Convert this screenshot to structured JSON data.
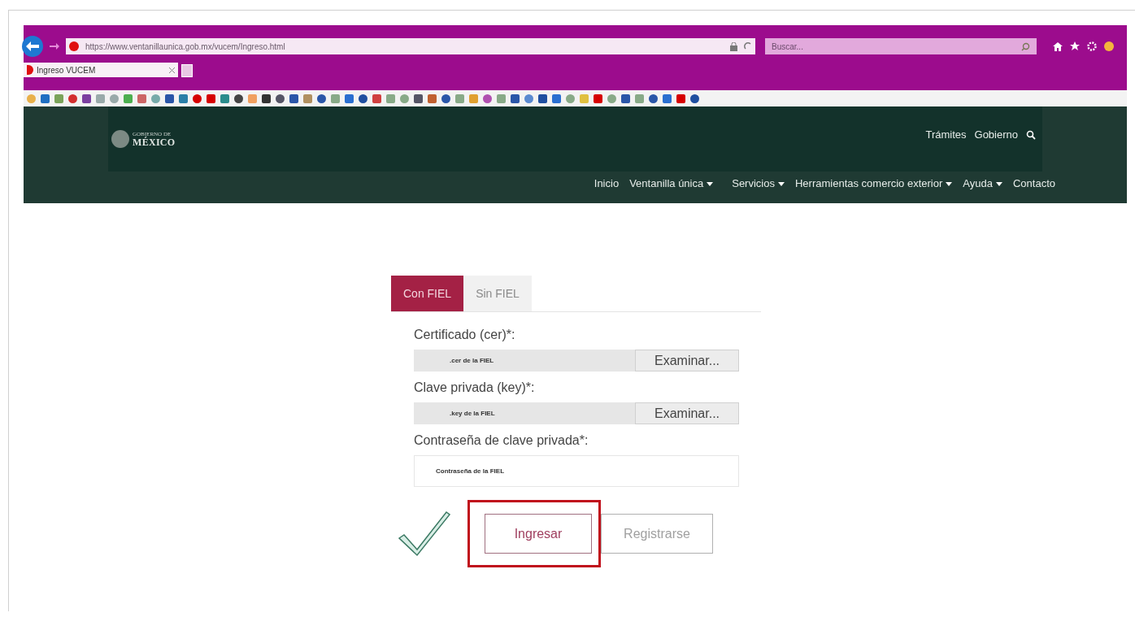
{
  "browser": {
    "url": "https://www.ventanillaunica.gob.mx/vucem/Ingreso.html",
    "search_placeholder": "Buscar...",
    "tab_title": "Ingreso VUCEM"
  },
  "header": {
    "logo_top": "GOBIERNO DE",
    "logo_main": "MÉXICO",
    "top_links": [
      "Trámites",
      "Gobierno"
    ],
    "nav": [
      {
        "label": "Inicio",
        "dropdown": false
      },
      {
        "label": "Ventanilla única",
        "dropdown": true
      },
      {
        "label": "Servicios",
        "dropdown": true
      },
      {
        "label": "Herramientas comercio exterior",
        "dropdown": true
      },
      {
        "label": "Ayuda",
        "dropdown": true
      },
      {
        "label": "Contacto",
        "dropdown": false
      }
    ]
  },
  "tabs": [
    {
      "label": "Con FIEL",
      "selected": true
    },
    {
      "label": "Sin FIEL",
      "selected": false
    }
  ],
  "fields": [
    {
      "kind": "file",
      "label": "Certificado (cer)*:",
      "value": ".cer de la FIEL",
      "button": "Examinar..."
    },
    {
      "kind": "file",
      "label": "Clave privada (key)*:",
      "value": ".key de la FIEL",
      "button": "Examinar..."
    },
    {
      "kind": "text",
      "label": "Contraseña de clave privada*:",
      "value": "Contraseña de la FIEL"
    }
  ],
  "buttons": [
    {
      "label": "Ingresar",
      "highlighted": true
    },
    {
      "label": "Registrarse",
      "highlighted": false
    }
  ]
}
